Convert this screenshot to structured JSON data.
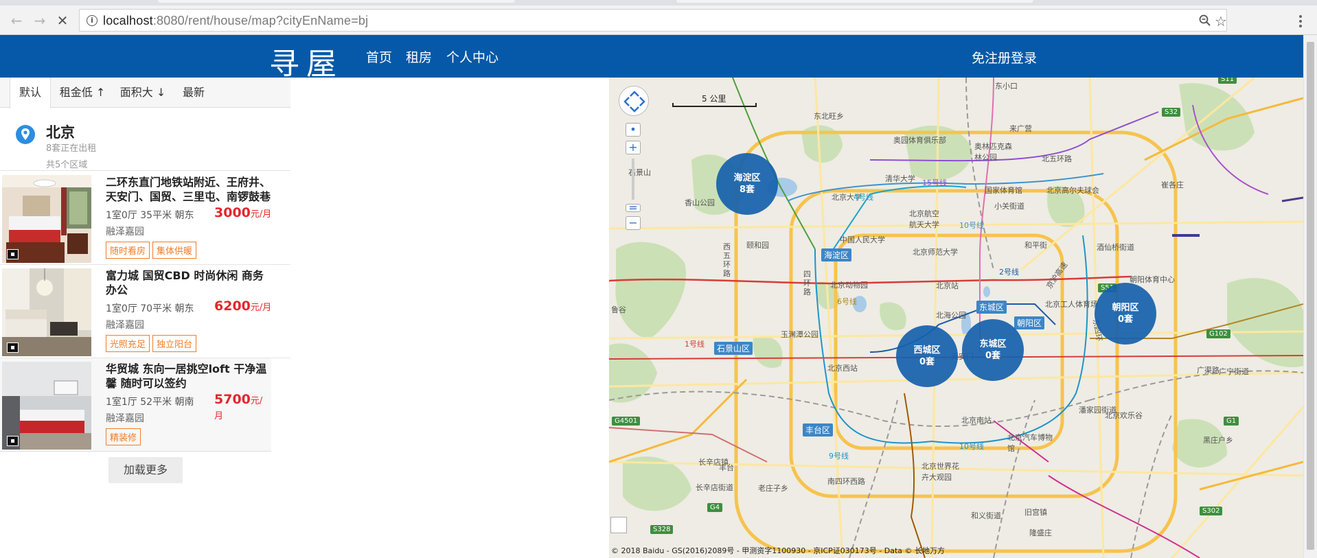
{
  "browser": {
    "url_host": "localhost",
    "url_rest": ":8080/rent/house/map?cityEnName=bj"
  },
  "header": {
    "logo": "寻屋",
    "nav": [
      "首页",
      "租房",
      "个人中心"
    ],
    "login": "免注册登录"
  },
  "sort_bar": {
    "items": [
      "默认",
      "租金低 ↑",
      "面积大 ↓",
      "最新"
    ],
    "active_index": 0
  },
  "city": {
    "name": "北京",
    "renting_text": "8套正在出租",
    "regions_text": "共5个区域"
  },
  "houses": [
    {
      "title": "二环东直门地铁站附近、王府井、天安门、国贸、三里屯、南锣鼓巷",
      "meta": "1室0厅 35平米  朝东",
      "price": "3000",
      "unit": "元/月",
      "community": "融泽嘉园",
      "tags": [
        "随时看房",
        "集体供暖"
      ]
    },
    {
      "title": "富力城 国贸CBD 时尚休闲 商务办公",
      "meta": "1室0厅 70平米  朝东",
      "price": "6200",
      "unit": "元/月",
      "community": "融泽嘉园",
      "tags": [
        "光照充足",
        "独立阳台"
      ]
    },
    {
      "title": "华贸城 东向一居挑空loft 干净温馨 随时可以签约",
      "meta": "1室1厅 52平米  朝南",
      "price": "5700",
      "unit": "元/月",
      "community": "融泽嘉园",
      "tags": [
        "精装修"
      ]
    }
  ],
  "load_more": "加载更多",
  "map": {
    "scale": "5 公里",
    "copyright": "© 2018 Baidu - GS(2016)2089号 - 甲测资字1100930 - 京ICP证030173号 - Data © 长地万方",
    "bubbles": [
      {
        "name": "海淀区",
        "count": "8套"
      },
      {
        "name": "西城区",
        "count": "0套"
      },
      {
        "name": "东城区",
        "count": "0套"
      },
      {
        "name": "朝阳区",
        "count": "0套"
      }
    ],
    "district_tags": [
      "海淀区",
      "石景山区",
      "丰台区",
      "东城区",
      "朝阳区"
    ],
    "labels": [
      "东小口",
      "东北旺乡",
      "来广营",
      "奥园体育俱乐部",
      "奥林匹克森林公园",
      "北五环路",
      "清华大学",
      "北京大学",
      "国家体育馆",
      "北京航空航天大学",
      "小关街道",
      "北京高尔夫球会",
      "崔各庄",
      "中国人民大学",
      "北京师范大学",
      "和平街",
      "酒仙桥街道",
      "颐和园",
      "北京动物园",
      "北京站",
      "北京工人体育场",
      "朝阳体育中心",
      "鲁谷",
      "玉渊潭公园",
      "北海公园",
      "北京西站",
      "天安门",
      "广渠路",
      "北京南站",
      "北京汽车博物馆",
      "潘家园街道",
      "北京欢乐谷",
      "黑庄户乡",
      "长辛店镇",
      "北京世界花卉大观园",
      "南四环西路",
      "和义街道",
      "旧宫镇",
      "隆盛庄",
      "长辛店街道",
      "老庄子乡",
      "香山公园",
      "广宁街道",
      "京沪高速",
      "东四环",
      "西五环路",
      "四环路",
      "石景山",
      "丰台"
    ],
    "metro": [
      "15号线",
      "10号线",
      "6号线",
      "4号线",
      "1号线",
      "9号线",
      "10号线",
      "2号线"
    ],
    "highways": [
      "S11",
      "S32",
      "S51",
      "G102",
      "G1",
      "G4501",
      "G4",
      "S328",
      "S302"
    ]
  }
}
